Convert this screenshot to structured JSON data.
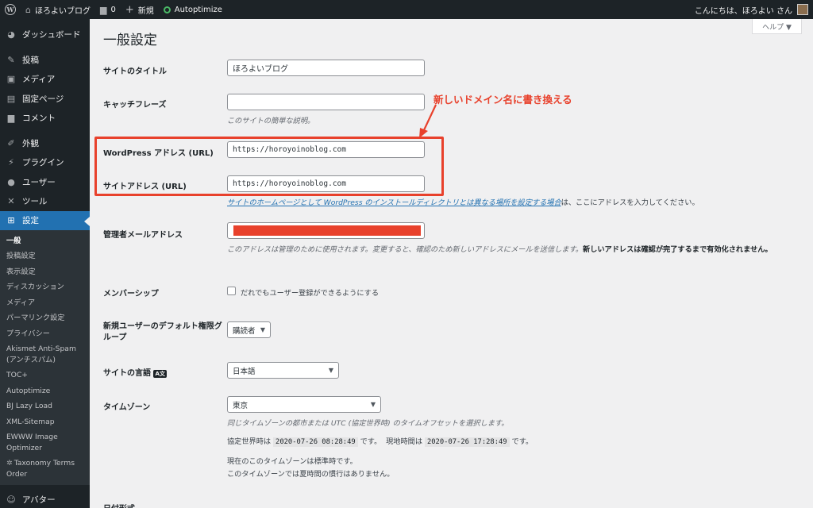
{
  "adminbar": {
    "site_name": "ほろよいブログ",
    "comments_count": "0",
    "new_label": "新規",
    "plugin_label": "Autoptimize",
    "greeting": "こんにちは、ほろよい さん"
  },
  "sidebar": {
    "items": [
      {
        "label": "ダッシュボード",
        "icon": "dashboard-icon"
      },
      {
        "label": "投稿",
        "icon": "pin-icon"
      },
      {
        "label": "メディア",
        "icon": "media-icon"
      },
      {
        "label": "固定ページ",
        "icon": "page-icon"
      },
      {
        "label": "コメント",
        "icon": "comment-icon"
      },
      {
        "label": "外観",
        "icon": "brush-icon"
      },
      {
        "label": "プラグイン",
        "icon": "plugin-icon"
      },
      {
        "label": "ユーザー",
        "icon": "user-icon"
      },
      {
        "label": "ツール",
        "icon": "wrench-icon"
      },
      {
        "label": "設定",
        "icon": "settings-icon"
      }
    ],
    "submenu": [
      "一般",
      "投稿設定",
      "表示設定",
      "ディスカッション",
      "メディア",
      "パーマリンク設定",
      "プライバシー",
      "Akismet Anti-Spam (アンチスパム)",
      "TOC+",
      "Autoptimize",
      "BJ Lazy Load",
      "XML-Sitemap",
      "EWWW Image Optimizer",
      "Taxonomy Terms Order"
    ],
    "bottom_item": "アバター"
  },
  "page": {
    "title": "一般設定",
    "help_label": "ヘルプ ▼"
  },
  "form": {
    "site_title_label": "サイトのタイトル",
    "site_title_value": "ほろよいブログ",
    "tagline_label": "キャッチフレーズ",
    "tagline_value": "",
    "tagline_desc": "このサイトの簡単な説明。",
    "wp_address_label": "WordPress アドレス (URL)",
    "wp_address_value": "https://horoyoinoblog.com",
    "site_address_label": "サイトアドレス (URL)",
    "site_address_value": "https://horoyoinoblog.com",
    "site_address_link": "サイトのホームページとして WordPress のインストールディレクトリとは異なる場所を設定する場合",
    "site_address_desc_tail": "は、ここにアドレスを入力してください。",
    "admin_email_label": "管理者メールアドレス",
    "admin_email_desc_1": "このアドレスは管理のために使用されます。変更すると、確認のため新しいアドレスにメールを送信します。",
    "admin_email_desc_bold": "新しいアドレスは確認が完了するまで有効化されません。",
    "membership_label": "メンバーシップ",
    "membership_checkbox": "だれでもユーザー登録ができるようにする",
    "default_role_label": "新規ユーザーのデフォルト権限グループ",
    "default_role_value": "購読者",
    "language_label": "サイトの言語",
    "language_value": "日本語",
    "timezone_label": "タイムゾーン",
    "timezone_value": "東京",
    "timezone_desc": "同じタイムゾーンの都市または UTC (協定世界時) のタイムオフセットを選択します。",
    "utc_label": "協定世界時は",
    "utc_time": "2020-07-26 08:28:49",
    "utc_tail": "です。",
    "local_label": "現地時間は",
    "local_time": "2020-07-26 17:28:49",
    "local_tail": "です。",
    "std_time_note": "現在のこのタイムゾーンは標準時です。",
    "dst_note": "このタイムゾーンでは夏時間の慣行はありません。",
    "date_format_label": "日付形式"
  },
  "annotation": {
    "text": "新しいドメイン名に書き換える",
    "color": "#e8412c"
  }
}
